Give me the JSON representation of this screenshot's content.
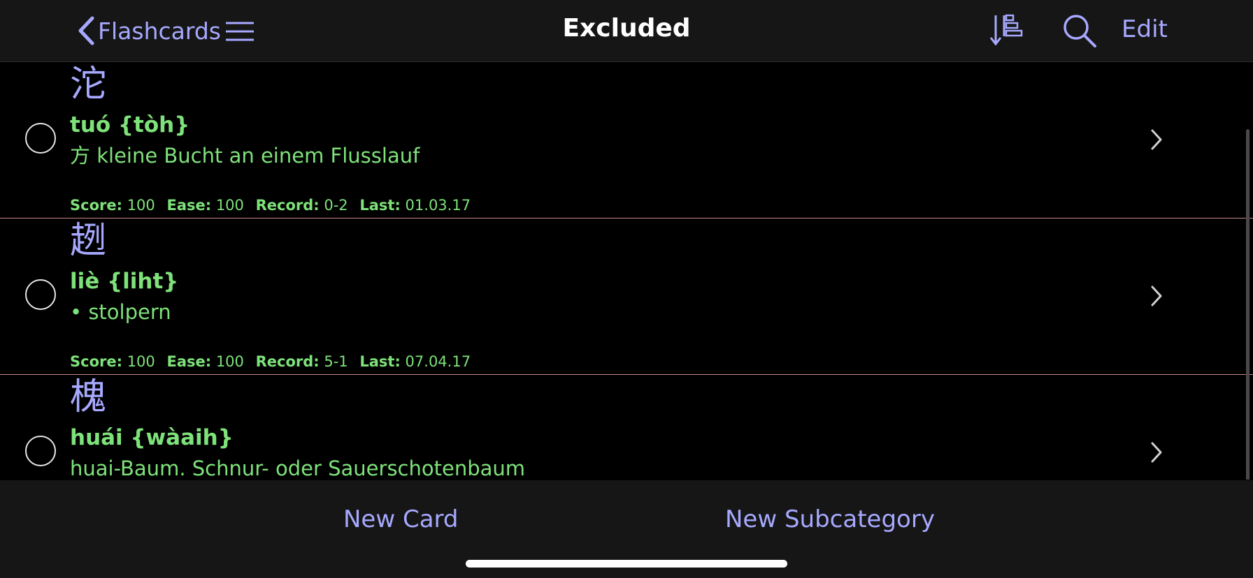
{
  "nav": {
    "back_label": "Flashcards",
    "title": "Excluded",
    "edit_label": "Edit"
  },
  "cards": [
    {
      "hanzi": "沱",
      "reading": "tuó {tòh}",
      "meaning": "方 kleine Bucht an einem Flusslauf",
      "score_label": "Score:",
      "score": "100",
      "ease_label": "Ease:",
      "ease": "100",
      "record_label": "Record:",
      "record": "0-2",
      "last_label": "Last:",
      "last": "01.03.17"
    },
    {
      "hanzi": "趔",
      "reading": "liè {liht}",
      "meaning": "• stolpern",
      "score_label": "Score:",
      "score": "100",
      "ease_label": "Ease:",
      "ease": "100",
      "record_label": "Record:",
      "record": "5-1",
      "last_label": "Last:",
      "last": "07.04.17"
    },
    {
      "hanzi": "槐",
      "reading": "huái {wàaih}",
      "meaning": "huai-Baum. Schnur- oder Sauerschotenbaum"
    }
  ],
  "toolbar": {
    "new_card_label": "New Card",
    "new_subcategory_label": "New Subcategory"
  },
  "colors": {
    "accent": "#a7a9ff",
    "green_text": "#7ee27a",
    "divider": "#c78a84",
    "bar_bg": "#161616"
  },
  "icons": [
    "chevron-left-icon",
    "hamburger-menu-icon",
    "sort-icon",
    "search-icon",
    "radio-circle-icon",
    "chevron-right-icon"
  ]
}
